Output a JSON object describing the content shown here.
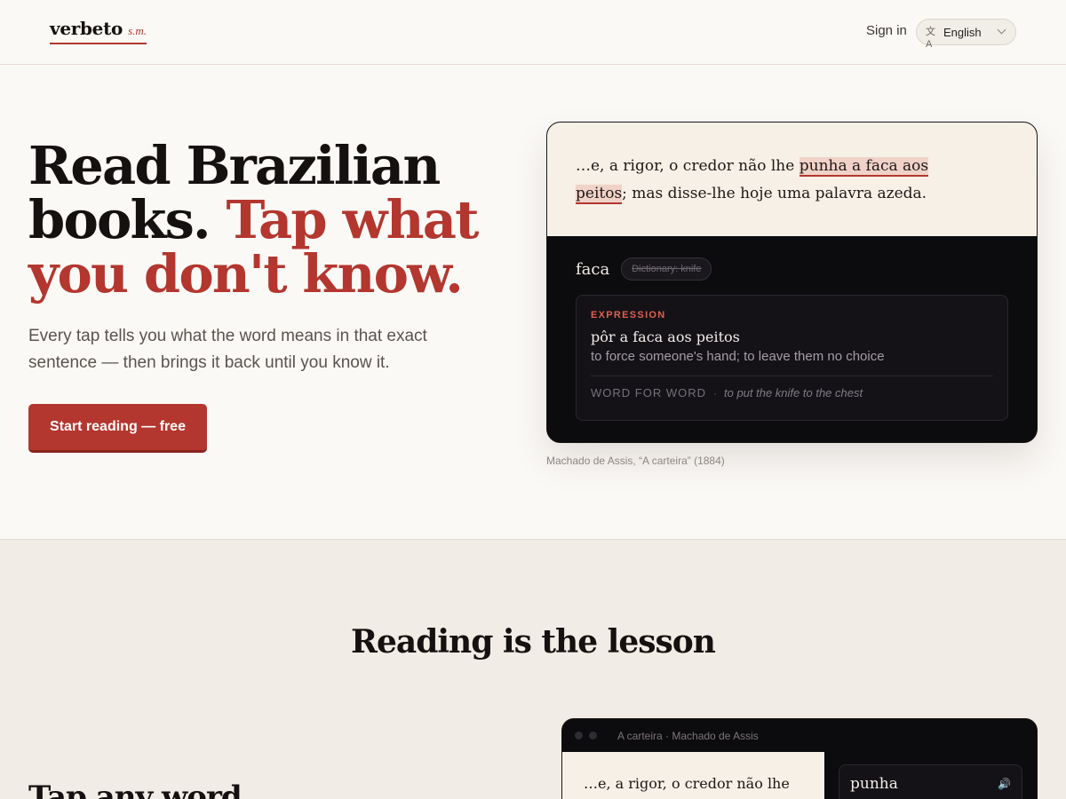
{
  "header": {
    "logo_name": "verbeto",
    "logo_suffix": "s.m.",
    "signin": "Sign in",
    "language": "English",
    "language_icon": "translate-icon",
    "chevron_icon": "chevron-down-icon"
  },
  "hero": {
    "title_line1": "Read Brazilian",
    "title_line2a": "books.",
    "title_line2b": "Tap what",
    "title_line3": "you don't know.",
    "subtitle": "Every tap tells you what the word means in that exact sentence — then brings it back until you know it.",
    "cta": "Start reading — free"
  },
  "demo": {
    "sentence_before": "…e, a rigor, o credor não lhe ",
    "sentence_highlight_1": "punha a faca aos",
    "sentence_highlight_2": "peitos",
    "sentence_after": "; mas disse-lhe hoje uma palavra azeda.",
    "word": "faca",
    "dictionary_pill": "Dictionary: knife",
    "expression_label": "EXPRESSION",
    "expression_phrase": "pôr a faca aos peitos",
    "expression_meaning": "to force someone's hand; to leave them no choice",
    "word_for_word_label": "WORD FOR WORD",
    "separator": "·",
    "word_for_word": "to put the knife to the chest",
    "caption": "Machado de Assis, “A carteira” (1884)"
  },
  "section2": {
    "title": "Reading is the lesson",
    "subtitle": "Tap any word",
    "app_title": "A carteira · Machado de Assis",
    "app_text": "…e, a rigor, o credor não lhe",
    "app_word": "punha",
    "speaker_icon": "speaker-icon"
  },
  "colors": {
    "accent": "#b3372f",
    "background": "#fbf9f6",
    "card_dark": "#0c0b0d",
    "card_paper": "#f6f0e6",
    "expression_label": "#e0604e"
  }
}
